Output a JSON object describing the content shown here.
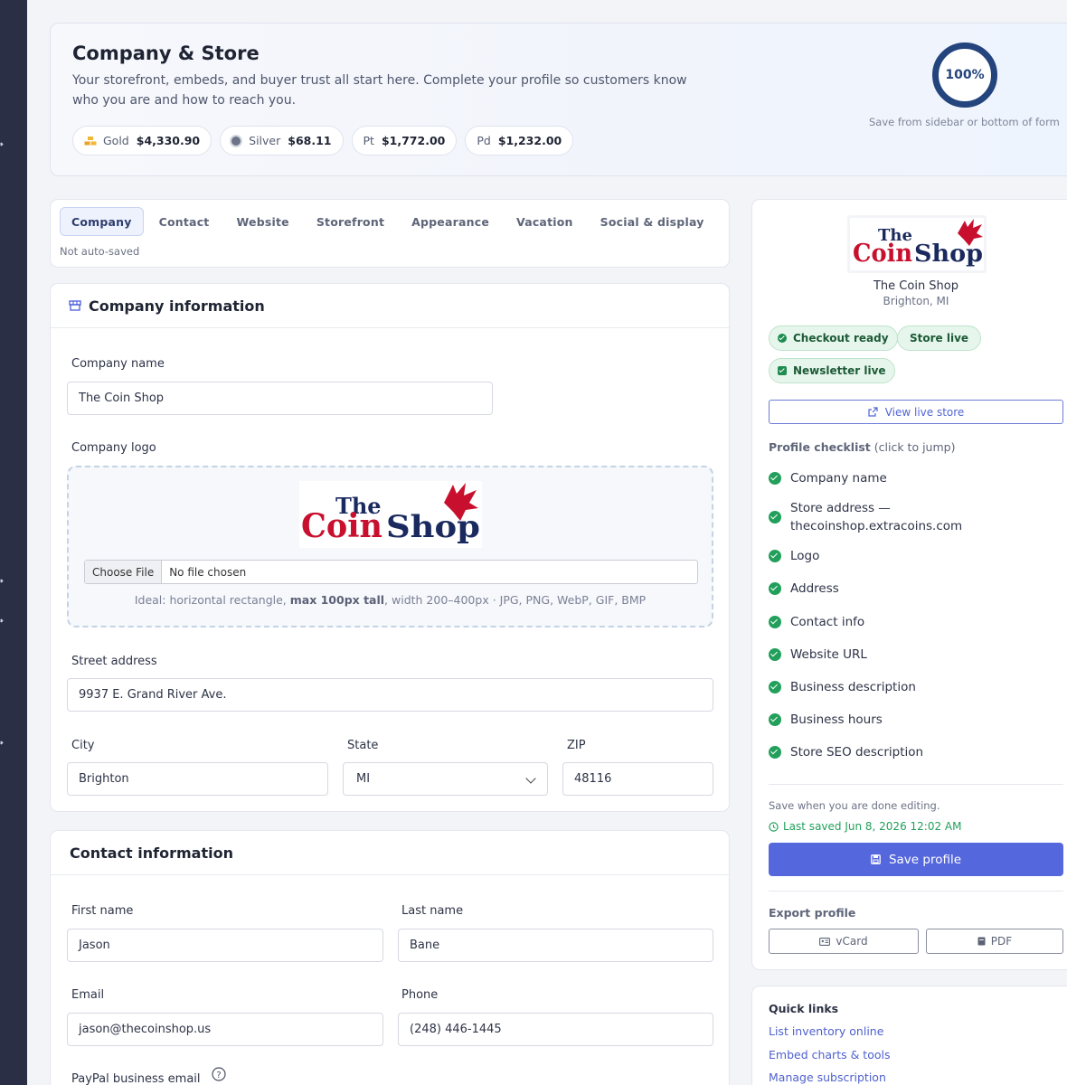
{
  "header": {
    "title": "Company & Store",
    "subtitle": "Your storefront, embeds, and buyer trust all start here. Complete your profile so customers know who you are and how to reach you.",
    "progress": "100%",
    "progress_value": 1.0,
    "save_hint": "Save from sidebar or bottom of form"
  },
  "prices": [
    {
      "name": "Gold",
      "value": "$4,330.90"
    },
    {
      "name": "Silver",
      "value": "$68.11"
    },
    {
      "name": "Pt",
      "value": "$1,772.00"
    },
    {
      "name": "Pd",
      "value": "$1,232.00"
    }
  ],
  "tabs": [
    {
      "label": "Company",
      "active": true
    },
    {
      "label": "Contact"
    },
    {
      "label": "Website"
    },
    {
      "label": "Storefront"
    },
    {
      "label": "Appearance"
    },
    {
      "label": "Vacation"
    },
    {
      "label": "Social & display"
    }
  ],
  "tabs_note": "Not auto-saved",
  "company": {
    "title": "Company information",
    "name_label": "Company name",
    "name_value": "The Coin Shop",
    "logo_label": "Company logo",
    "logo_text": {
      "the": "The",
      "coin": "Coin",
      "shop": "Shop"
    },
    "file_button": "Choose File",
    "file_status": "No file chosen",
    "tip_pre": "Ideal: horizontal rectangle, ",
    "tip_bold": "max 100px tall",
    "tip_post": ", width 200–400px · JPG, PNG, WebP, GIF, BMP",
    "street_label": "Street address",
    "street_value": "9937 E. Grand River Ave.",
    "city_label": "City",
    "city_value": "Brighton",
    "state_label": "State",
    "state_value": "MI",
    "zip_label": "ZIP",
    "zip_value": "48116"
  },
  "contact": {
    "title": "Contact information",
    "first_label": "First name",
    "first_value": "Jason",
    "last_label": "Last name",
    "last_value": "Bane",
    "email_label": "Email",
    "email_value": "jason@thecoinshop.us",
    "phone_label": "Phone",
    "phone_value": "(248) 446-1445",
    "paypal_label": "PayPal business email"
  },
  "profile": {
    "name": "The Coin Shop",
    "location": "Brighton, MI",
    "badges": {
      "checkout": "Checkout ready",
      "store": "Store live",
      "newsletter": "Newsletter live"
    },
    "view_store": "View live store",
    "checklist_title": "Profile checklist",
    "checklist_hint": "(click to jump)",
    "checklist": [
      "Company name",
      "Store address — thecoinshop.extracoins.com",
      "Logo",
      "Address",
      "Contact info",
      "Website URL",
      "Business description",
      "Business hours",
      "Store SEO description"
    ],
    "save_note": "Save when you are done editing.",
    "last_saved": "Last saved Jun 8, 2026 12:02 AM",
    "save_button": "Save profile",
    "export_title": "Export profile",
    "vcard": "vCard",
    "pdf": "PDF"
  },
  "quick_links": {
    "title": "Quick links",
    "links": [
      "List inventory online",
      "Embed charts & tools",
      "Manage subscription"
    ]
  },
  "colors": {
    "accent": "#5567dd",
    "success": "#22a05b",
    "sidebar": "#2a2f45",
    "logo_red": "#c8102e",
    "logo_navy": "#1b2a5e"
  }
}
